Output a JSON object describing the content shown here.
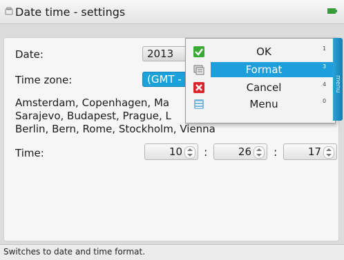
{
  "window": {
    "title": "Date time - settings",
    "icons": {
      "title": "settings-app-icon",
      "battery": "battery-icon"
    }
  },
  "form": {
    "date_label": "Date:",
    "date_value": "2013",
    "timezone_label": "Time zone:",
    "timezone_value": "(GMT -",
    "timezone_cities_line1": "Amsterdam, Copenhagen, Ma",
    "timezone_cities_line2": "Sarajevo, Budapest, Prague, L",
    "timezone_cities_line3": "Berlin, Bern, Rome, Stockholm, Vienna",
    "time_label": "Time:",
    "time_hours": "10",
    "time_minutes": "26",
    "time_seconds": "17",
    "time_separator": ":"
  },
  "context_menu": {
    "side_tab_label": "menu",
    "items": [
      {
        "label": "OK",
        "shortcut": "1",
        "icon": "ok-check-icon"
      },
      {
        "label": "Format",
        "shortcut": "3",
        "icon": "format-icon",
        "active": true
      },
      {
        "label": "Cancel",
        "shortcut": "4",
        "icon": "cancel-x-icon"
      },
      {
        "label": "Menu",
        "shortcut": "0",
        "icon": "menu-icon"
      }
    ]
  },
  "status": {
    "text": "Switches to date and time format."
  },
  "colors": {
    "accent": "#1e9fdc",
    "ok_green": "#3aa935",
    "cancel_red": "#d9262b"
  }
}
